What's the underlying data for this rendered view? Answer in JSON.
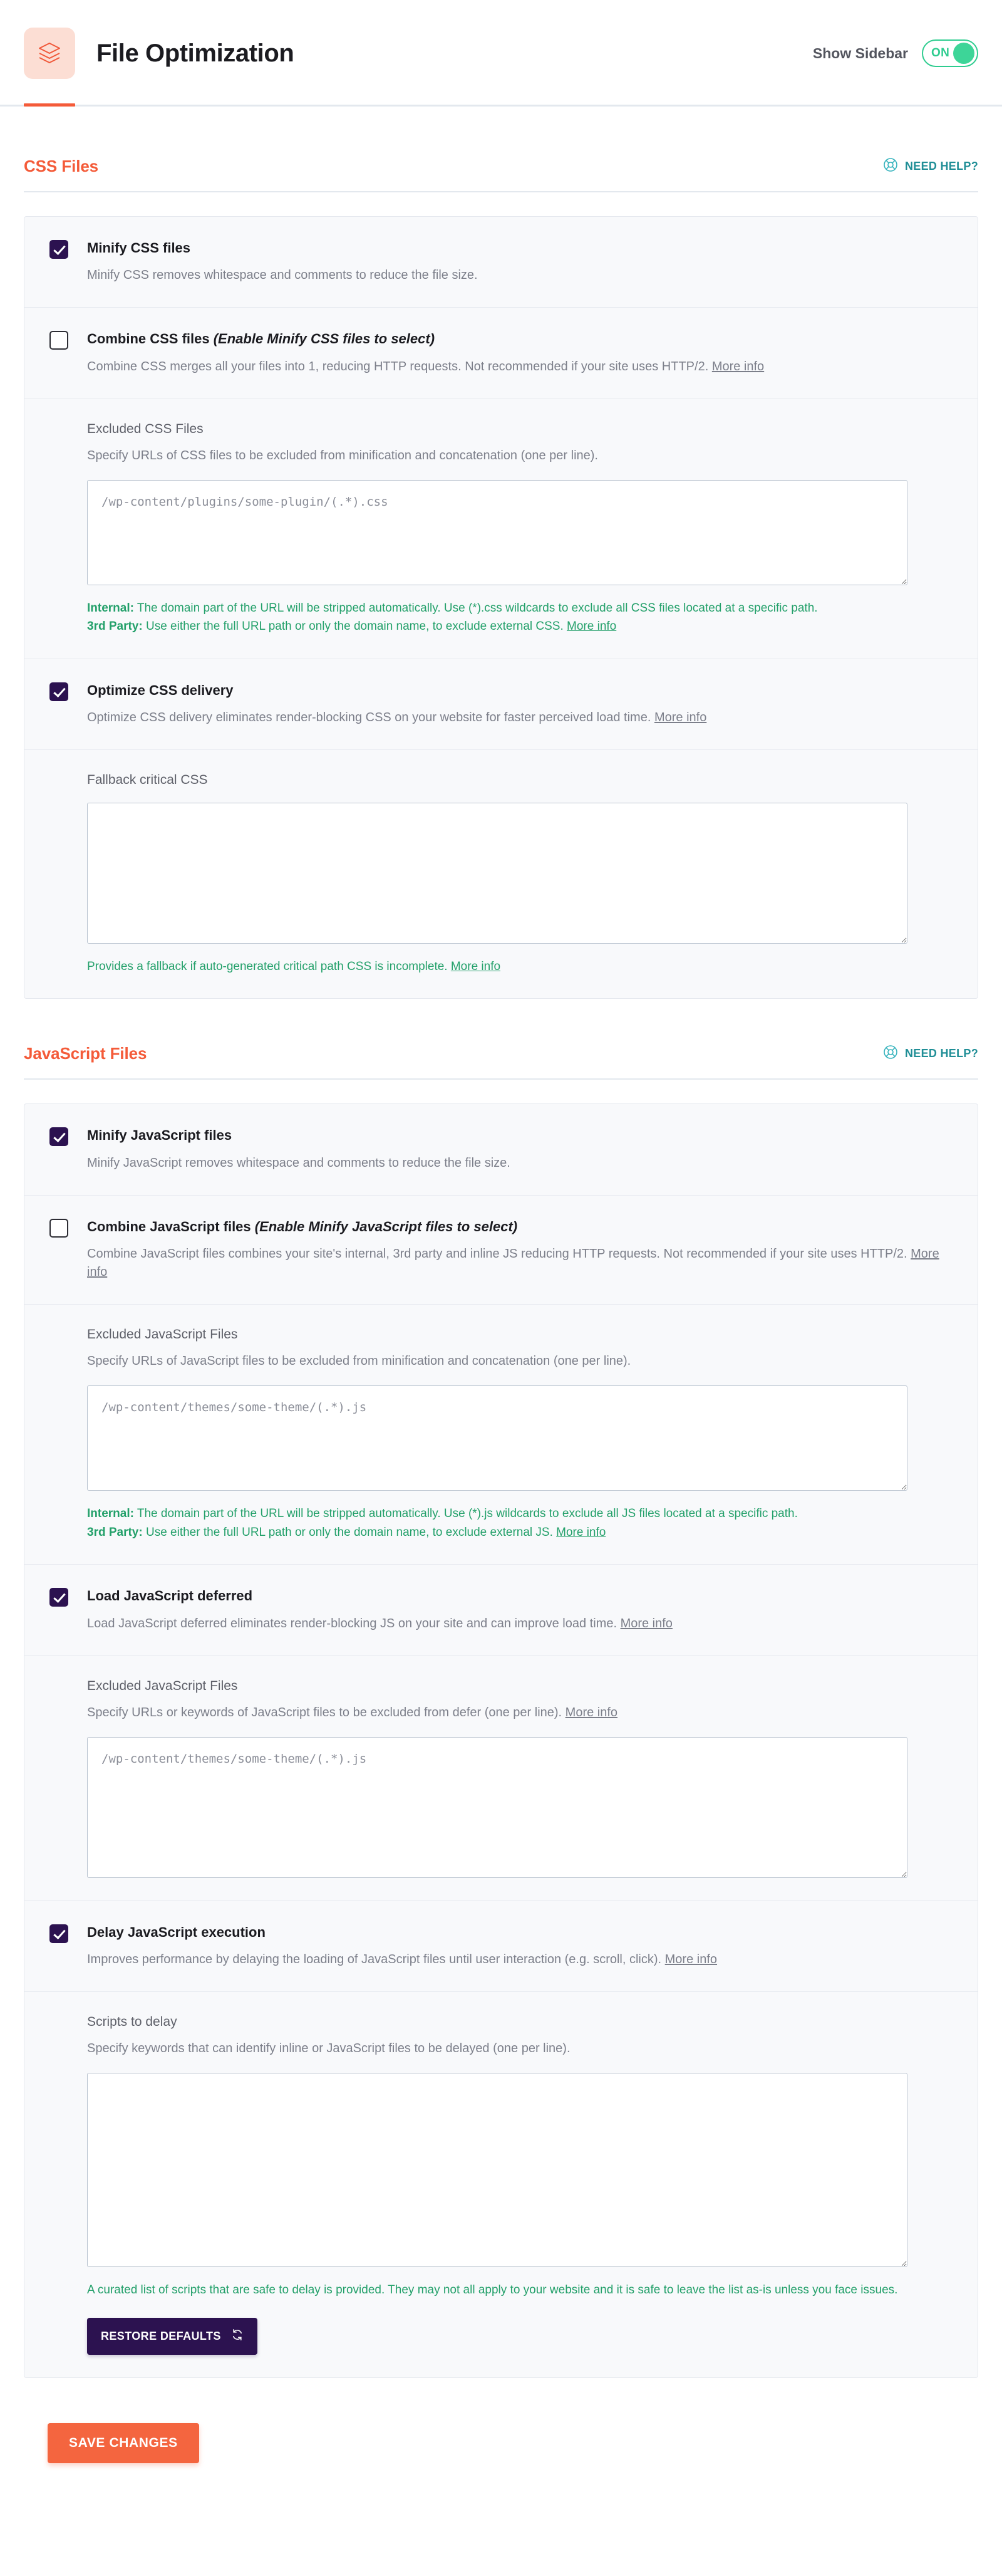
{
  "header": {
    "brand_icon": "layers-icon",
    "title": "File Optimization",
    "sidebar_label": "Show Sidebar",
    "toggle_state": "ON",
    "accent_color": "#f45b39",
    "toggle_color": "#3dd598"
  },
  "need_help": {
    "icon": "lifebuoy-icon",
    "label": "NEED HELP?",
    "color": "#1f8e96"
  },
  "sections": {
    "css": {
      "title": "CSS Files",
      "minify": {
        "label": "Minify CSS files",
        "checked": true,
        "desc": "Minify CSS removes whitespace and comments to reduce the file size."
      },
      "combine": {
        "label": "Combine CSS files ",
        "label_em": "(Enable Minify CSS files to select)",
        "checked": false,
        "desc": "Combine CSS merges all your files into 1, reducing HTTP requests. Not recommended if your site uses HTTP/2. ",
        "more_info": "More info"
      },
      "excluded": {
        "label": "Excluded CSS Files",
        "desc": "Specify URLs of CSS files to be excluded from minification and concatenation (one per line).",
        "placeholder": "/wp-content/plugins/some-plugin/(.*).css",
        "value": "",
        "hint_internal_label": "Internal:",
        "hint_internal_text": " The domain part of the URL will be stripped automatically. Use (*).css wildcards to exclude all CSS files located at a specific path.",
        "hint_thirdparty_label": "3rd Party:",
        "hint_thirdparty_text": " Use either the full URL path or only the domain name, to exclude external CSS. ",
        "hint_more_info": "More info"
      },
      "optimize_delivery": {
        "label": "Optimize CSS delivery",
        "checked": true,
        "desc": "Optimize CSS delivery eliminates render-blocking CSS on your website for faster perceived load time. ",
        "more_info": "More info"
      },
      "fallback": {
        "label": "Fallback critical CSS",
        "placeholder": "",
        "value": "",
        "hint_text": "Provides a fallback if auto-generated critical path CSS is incomplete. ",
        "hint_more_info": "More info"
      }
    },
    "javascript": {
      "title": "JavaScript Files",
      "minify": {
        "label": "Minify JavaScript files",
        "checked": true,
        "desc": "Minify JavaScript removes whitespace and comments to reduce the file size."
      },
      "combine": {
        "label": "Combine JavaScript files ",
        "label_em": "(Enable Minify JavaScript files to select)",
        "checked": false,
        "desc": "Combine JavaScript files combines your site's internal, 3rd party and inline JS reducing HTTP requests. Not recommended if your site uses HTTP/2. ",
        "more_info": "More info"
      },
      "excluded_minify": {
        "label": "Excluded JavaScript Files",
        "desc": "Specify URLs of JavaScript files to be excluded from minification and concatenation (one per line).",
        "placeholder": "/wp-content/themes/some-theme/(.*).js",
        "value": "",
        "hint_internal_label": "Internal:",
        "hint_internal_text": " The domain part of the URL will be stripped automatically. Use (*).js wildcards to exclude all JS files located at a specific path.",
        "hint_thirdparty_label": "3rd Party:",
        "hint_thirdparty_text": " Use either the full URL path or only the domain name, to exclude external JS. ",
        "hint_more_info": "More info"
      },
      "defer": {
        "label": "Load JavaScript deferred",
        "checked": true,
        "desc": "Load JavaScript deferred eliminates render-blocking JS on your site and can improve load time. ",
        "more_info": "More info"
      },
      "excluded_defer": {
        "label": "Excluded JavaScript Files",
        "desc": "Specify URLs or keywords of JavaScript files to be excluded from defer (one per line). ",
        "desc_more_info": "More info",
        "placeholder": "/wp-content/themes/some-theme/(.*).js",
        "value": ""
      },
      "delay": {
        "label": "Delay JavaScript execution",
        "checked": true,
        "desc": "Improves performance by delaying the loading of JavaScript files until user interaction (e.g. scroll, click). ",
        "more_info": "More info"
      },
      "scripts_to_delay": {
        "label": "Scripts to delay",
        "desc": "Specify keywords that can identify inline or JavaScript files to be delayed (one per line).",
        "placeholder": "",
        "value": "",
        "hint_text": "A curated list of scripts that are safe to delay is provided. They may not all apply to your website and it is safe to leave the list as-is unless you face issues.",
        "restore_button": "RESTORE DEFAULTS",
        "restore_icon": "refresh-icon"
      }
    }
  },
  "footer": {
    "save_label": "SAVE CHANGES",
    "save_color": "#f4653f"
  }
}
